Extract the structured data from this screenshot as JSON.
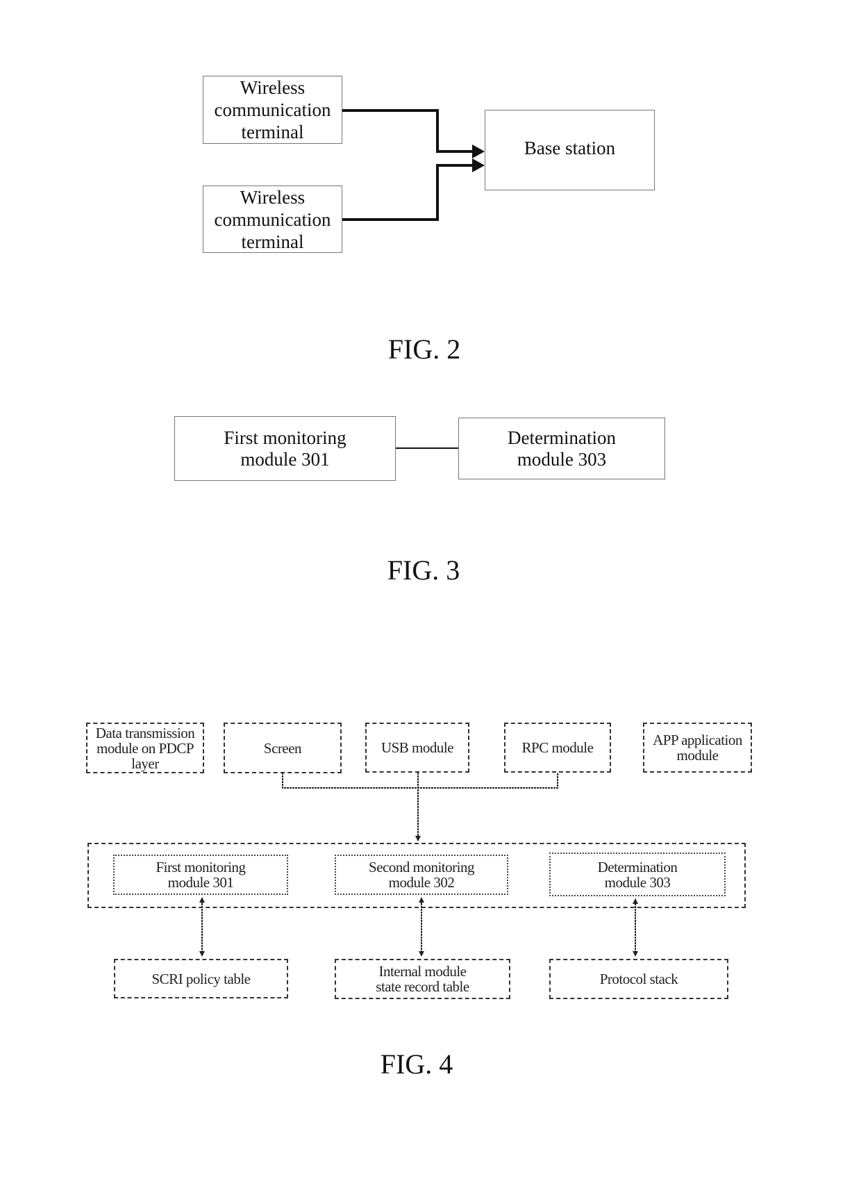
{
  "figures": {
    "fig2": {
      "caption": "FIG. 2",
      "terminal_1": "Wireless\ncommunication\nterminal",
      "terminal_2": "Wireless\ncommunication\nterminal",
      "base_station": "Base station"
    },
    "fig3": {
      "caption": "FIG. 3",
      "first_monitoring": "First monitoring\nmodule 301",
      "determination": "Determination\nmodule 303"
    },
    "fig4": {
      "caption": "FIG. 4",
      "top_row": {
        "pdcp": "Data transmission\nmodule on PDCP\nlayer",
        "screen": "Screen",
        "usb": "USB module",
        "rpc": "RPC module",
        "app": "APP application\nmodule"
      },
      "middle_row": {
        "first_monitoring": "First monitoring\nmodule 301",
        "second_monitoring": "Second monitoring\nmodule 302",
        "determination": "Determination\nmodule 303"
      },
      "bottom_row": {
        "scri": "SCRI policy table",
        "internal_state": "Internal module\nstate record table",
        "protocol_stack": "Protocol stack"
      }
    }
  }
}
